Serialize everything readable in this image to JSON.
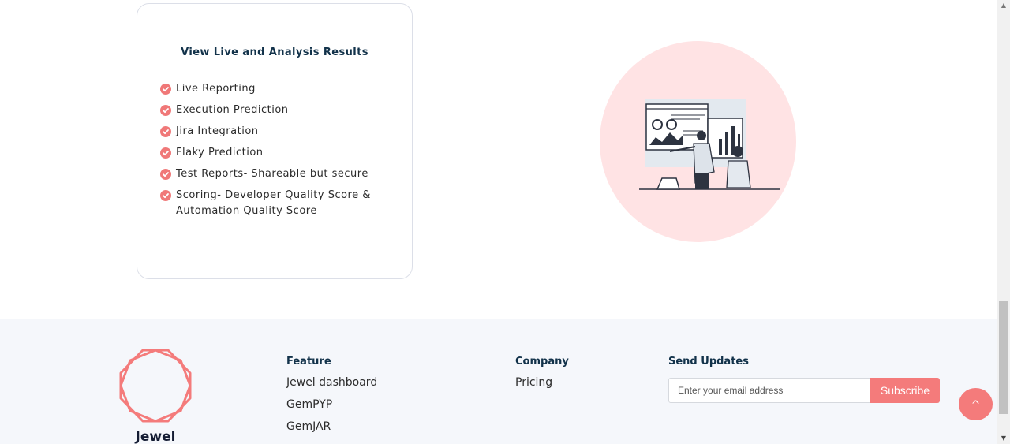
{
  "card": {
    "title": "View Live and Analysis Results",
    "features": [
      "Live Reporting",
      "Execution Prediction",
      "Jira Integration",
      "Flaky Prediction",
      "Test Reports- Shareable but secure",
      "Scoring- Developer Quality Score & Automation Quality Score"
    ]
  },
  "footer": {
    "brand": "Jewel",
    "feature": {
      "heading": "Feature",
      "links": [
        "Jewel dashboard",
        "GemPYP",
        "GemJAR"
      ]
    },
    "company": {
      "heading": "Company",
      "links": [
        "Pricing"
      ]
    },
    "updates": {
      "heading": "Send Updates",
      "email_placeholder": "Enter your email address",
      "subscribe_label": "Subscribe"
    },
    "back_to_top_label": "^"
  },
  "colors": {
    "accent": "#f47b7b",
    "heading": "#12324a",
    "illustration_bg": "#ffe3e4",
    "footer_bg": "#f5f7fb"
  }
}
